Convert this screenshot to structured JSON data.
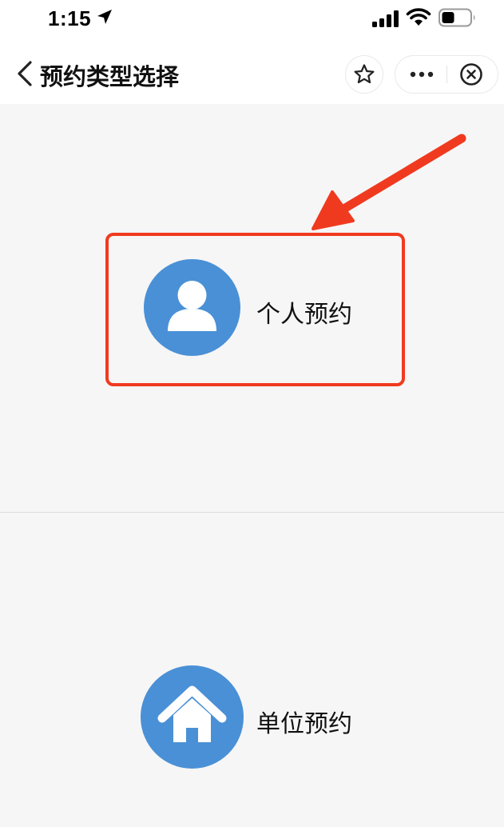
{
  "status_bar": {
    "time": "1:15"
  },
  "nav_bar": {
    "title": "预约类型选择"
  },
  "options": {
    "personal": {
      "label": "个人预约",
      "icon": "user-icon"
    },
    "unit": {
      "label": "单位预约",
      "icon": "home-icon"
    }
  },
  "colors": {
    "accent_blue": "#4a90d6",
    "highlight_red": "#f03a1f",
    "background": "#f6f6f6"
  }
}
